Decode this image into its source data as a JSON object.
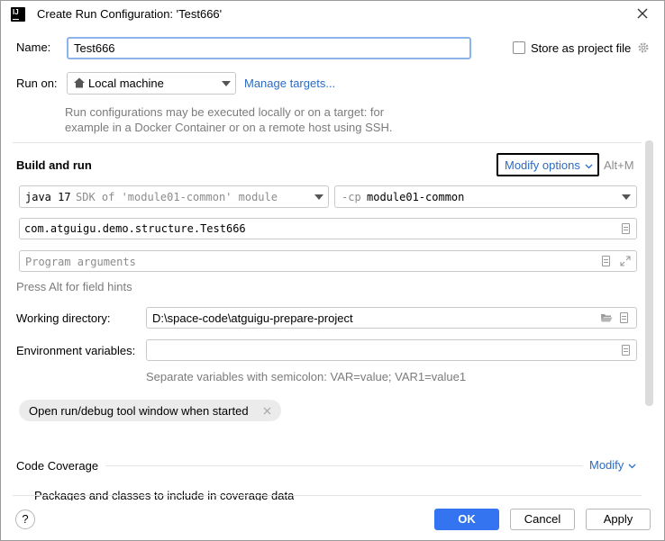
{
  "window": {
    "app_icon": "IJ",
    "title": "Create Run Configuration: 'Test666'",
    "close_icon": "close-icon"
  },
  "name_row": {
    "label": "Name:",
    "value": "Test666",
    "store_label": "Store as project file",
    "store_checked": false
  },
  "run_on": {
    "label": "Run on:",
    "selected": "Local machine",
    "manage_link": "Manage targets...",
    "description_line1": "Run configurations may be executed locally or on a target: for",
    "description_line2": "example in a Docker Container or on a remote host using SSH."
  },
  "build_and_run": {
    "heading": "Build and run",
    "modify_options": "Modify options",
    "shortcut": "Alt+M",
    "jre": "java 17",
    "jre_hint": "SDK of 'module01-common' module",
    "cp_prefix": "-cp",
    "cp_module": "module01-common",
    "main_class": "com.atguigu.demo.structure.Test666",
    "program_args_placeholder": "Program arguments",
    "field_hints": "Press Alt for field hints"
  },
  "working_directory": {
    "label": "Working directory:",
    "value": "D:\\space-code\\atguigu-prepare-project"
  },
  "environment": {
    "label": "Environment variables:",
    "value": "",
    "hint": "Separate variables with semicolon: VAR=value; VAR1=value1"
  },
  "tag": {
    "label": "Open run/debug tool window when started"
  },
  "code_coverage": {
    "heading": "Code Coverage",
    "modify": "Modify",
    "packages_text": "Packages and classes to include in coverage data"
  },
  "footer": {
    "help": "?",
    "ok": "OK",
    "cancel": "Cancel",
    "apply": "Apply"
  },
  "colors": {
    "accent": "#2a6bc4",
    "ok_button": "#3574f0",
    "focus_border": "#6ea0e8"
  }
}
